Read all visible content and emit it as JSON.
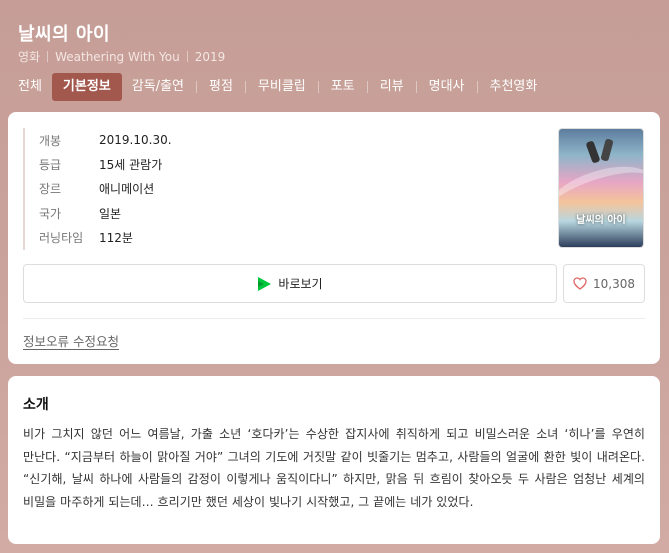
{
  "header": {
    "title": "날씨의 아이",
    "category": "영화",
    "original_title": "Weathering With You",
    "year": "2019"
  },
  "tabs": [
    {
      "label": "전체"
    },
    {
      "label": "기본정보"
    },
    {
      "label": "감독/출연"
    },
    {
      "label": "평점"
    },
    {
      "label": "무비클립"
    },
    {
      "label": "포토"
    },
    {
      "label": "리뷰"
    },
    {
      "label": "명대사"
    },
    {
      "label": "추천영화"
    }
  ],
  "active_tab": "기본정보",
  "info": [
    {
      "key": "개봉",
      "value": "2019.10.30."
    },
    {
      "key": "등급",
      "value": "15세 관람가"
    },
    {
      "key": "장르",
      "value": "애니메이션"
    },
    {
      "key": "국가",
      "value": "일본"
    },
    {
      "key": "러닝타임",
      "value": "112분"
    }
  ],
  "poster": {
    "title_text": "날씨의 아이"
  },
  "actions": {
    "watch_label": "바로보기",
    "like_count": "10,308"
  },
  "report_link": "정보오류 수정요청",
  "intro": {
    "heading": "소개",
    "body": "비가 그치지 않던 어느 여름날, 가출 소년 ‘호다카’는 수상한 잡지사에 취직하게 되고 비밀스러운 소녀 ‘히나’를 우연히 만난다. “지금부터 하늘이 맑아질 거야” 그녀의 기도에 거짓말 같이 빗줄기는 멈추고, 사람들의 얼굴에 환한 빛이 내려온다. “신기해, 날씨 하나에 사람들의 감정이 이렇게나 움직이다니” 하지만, 맑음 뒤 흐림이 찾아오듯 두 사람은 엄청난 세계의 비밀을 마주하게 되는데… 흐리기만 했던 세상이 빛나기 시작했고, 그 끝에는 네가 있었다."
  },
  "colors": {
    "active_tab_bg": "#a2584c",
    "play_icon": "#00c73c",
    "heart_icon": "#e06b6b"
  }
}
